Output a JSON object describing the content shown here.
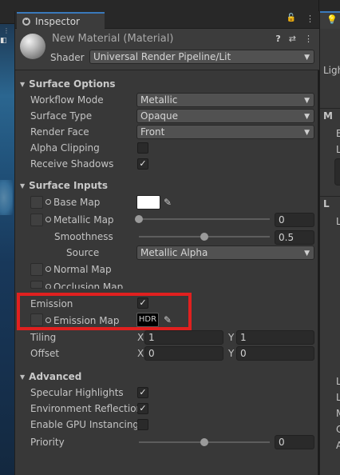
{
  "scene": {
    "menu_glyph": "⋮",
    "control_glyph": "◧"
  },
  "inspector": {
    "tab_title": "Inspector",
    "lock_glyph": "🔓",
    "more_glyph": "⋮",
    "material_name": "New Material (Material)",
    "help_glyph": "?",
    "settings_glyph": "⇄",
    "menu_glyph": "⋮",
    "shader_label": "Shader",
    "shader_value": "Universal Render Pipeline/Lit",
    "surface_options": {
      "title": "Surface Options",
      "workflow_mode_label": "Workflow Mode",
      "workflow_mode_value": "Metallic",
      "surface_type_label": "Surface Type",
      "surface_type_value": "Opaque",
      "render_face_label": "Render Face",
      "render_face_value": "Front",
      "alpha_clipping_label": "Alpha Clipping",
      "alpha_clipping_checked": false,
      "receive_shadows_label": "Receive Shadows",
      "receive_shadows_checked": true
    },
    "surface_inputs": {
      "title": "Surface Inputs",
      "base_map_label": "Base Map",
      "base_map_color": "#ffffff",
      "metallic_map_label": "Metallic Map",
      "metallic_value": "0",
      "metallic_level": 0.0,
      "smoothness_label": "Smoothness",
      "smoothness_value": "0.5",
      "smoothness_level": 0.5,
      "source_label": "Source",
      "source_value": "Metallic Alpha",
      "normal_map_label": "Normal Map",
      "occlusion_map_label": "Occlusion Map",
      "emission_label": "Emission",
      "emission_checked": true,
      "emission_map_label": "Emission Map",
      "emission_color_text": "HDR",
      "emission_color": "#000000",
      "tiling_label": "Tiling",
      "tiling_x_axis": "X",
      "tiling_x": "1",
      "tiling_y_axis": "Y",
      "tiling_y": "1",
      "offset_label": "Offset",
      "offset_x_axis": "X",
      "offset_x": "0",
      "offset_y_axis": "Y",
      "offset_y": "0"
    },
    "advanced": {
      "title": "Advanced",
      "specular_label": "Specular Highlights",
      "specular_checked": true,
      "env_reflection_label": "Environment Reflection",
      "env_reflection_checked": true,
      "gpu_instancing_label": "Enable GPU Instancing",
      "gpu_instancing_checked": false,
      "priority_label": "Priority",
      "priority_value": "0",
      "priority_level": 0.5
    }
  },
  "right_panel": {
    "tab_glyph": "💡",
    "lighting_fragment": "Ligh",
    "frag_m1": "M",
    "frag_b": "B",
    "frag_l1": "L",
    "frag_l2": "L",
    "frag_l3": "L",
    "frag_l4": "L",
    "frag_l5": "L",
    "frag_l6": "L",
    "frag_m2": "M",
    "frag_c": "C",
    "frag_a": "A"
  },
  "colors": {
    "accent_tab": "#3a79bb",
    "highlight_box": "#e0201f",
    "panel_bg": "#383838"
  }
}
